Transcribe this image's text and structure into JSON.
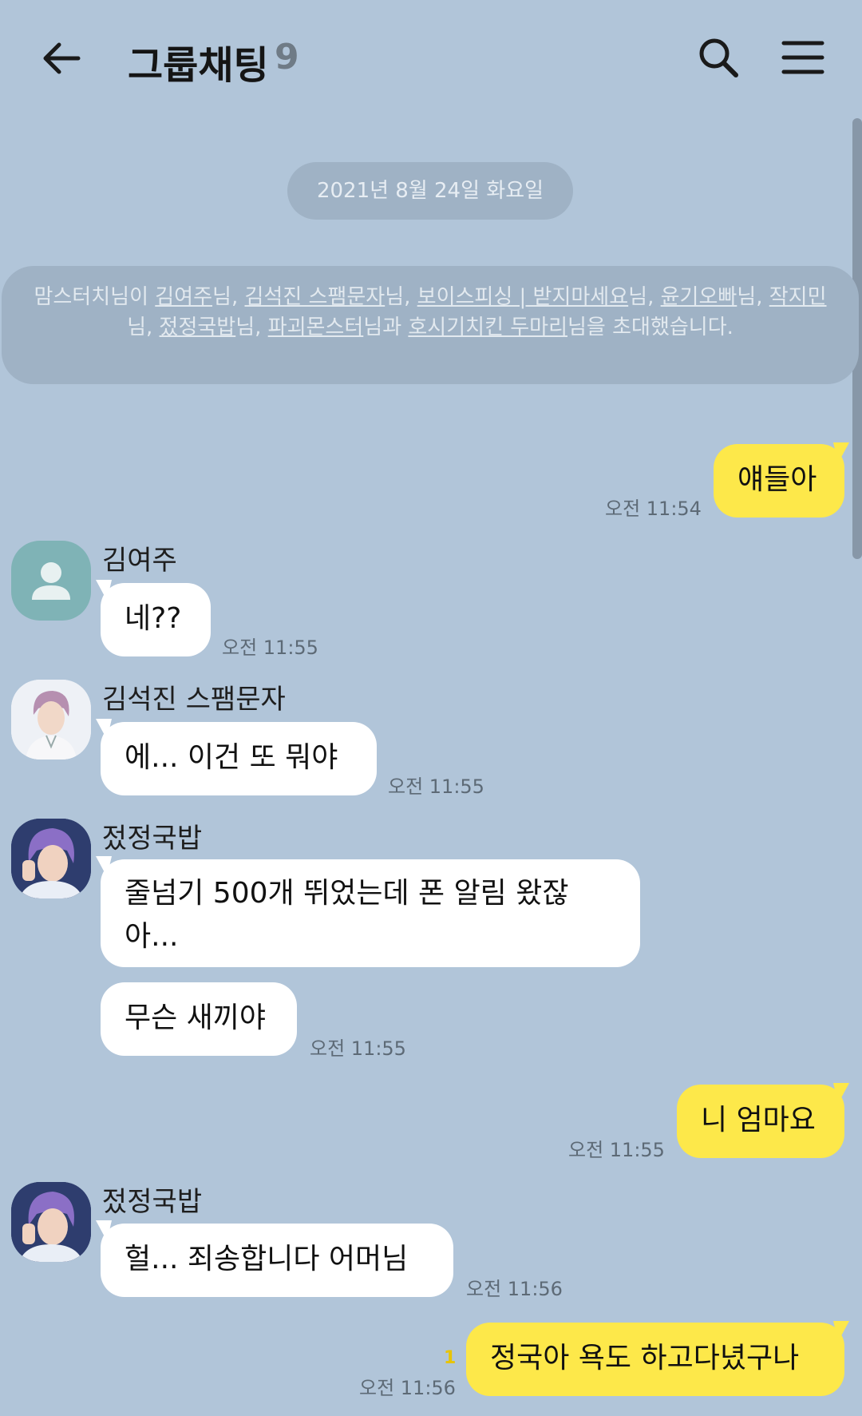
{
  "header": {
    "title": "그룹채팅",
    "member_count": "9"
  },
  "date_divider": "2021년 8월 24일 화요일",
  "notice": {
    "inviter": "맘스터치님이",
    "names": [
      "김여주",
      "김석진 스팸문자",
      "보이스피싱 | 받지마세요",
      "윤기오빠",
      "작지민",
      "젔정국밥",
      "파괴몬스터",
      "호시기치킨 두마리"
    ],
    "suffix": "님을 초대했습니다."
  },
  "messages": [
    {
      "side": "me",
      "text": "얘들아",
      "time": "오전 11:54"
    },
    {
      "side": "other",
      "sender": "김여주",
      "text": "네??",
      "time": "오전 11:55"
    },
    {
      "side": "other",
      "sender": "김석진 스팸문자",
      "text": "에... 이건 또 뭐야",
      "time": "오전 11:55"
    },
    {
      "side": "other",
      "sender": "젔정국밥",
      "text": "줄넘기 500개 뛰었는데 폰 알림 왔잖아...",
      "time": ""
    },
    {
      "side": "other",
      "sender": "",
      "text": "무슨 새끼야",
      "time": "오전 11:55"
    },
    {
      "side": "me",
      "text": "니 엄마요",
      "time": "오전 11:55"
    },
    {
      "side": "other",
      "sender": "젔정국밥",
      "text": "헐... 죄송합니다 어머님",
      "time": "오전 11:56"
    },
    {
      "side": "me",
      "text": "정국아 욕도 하고다녔구나",
      "time": "오전 11:56",
      "unread": "1"
    }
  ]
}
